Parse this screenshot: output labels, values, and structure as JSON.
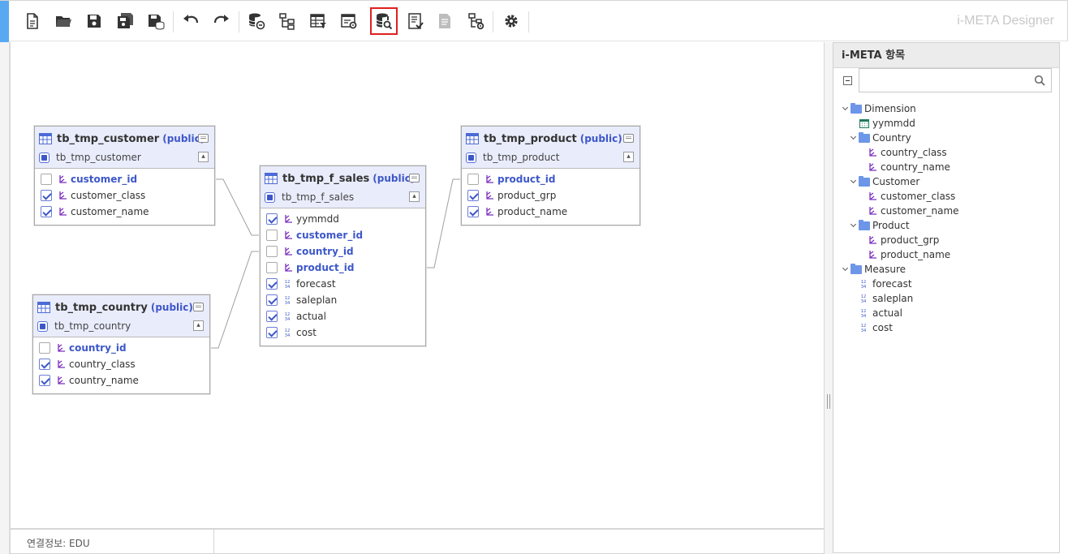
{
  "app": {
    "brand": "i-META Designer"
  },
  "toolbar": {
    "buttons": [
      {
        "name": "new-document",
        "icon": "new-document-icon"
      },
      {
        "name": "open-folder",
        "icon": "folder-open-icon"
      },
      {
        "name": "save",
        "icon": "save-icon"
      },
      {
        "name": "save-as",
        "icon": "save-as-icon"
      },
      {
        "name": "save-db",
        "icon": "save-database-icon"
      },
      {
        "name": "undo",
        "icon": "undo-icon"
      },
      {
        "name": "redo",
        "icon": "redo-icon"
      },
      {
        "name": "db-link",
        "icon": "database-link-icon"
      },
      {
        "name": "tree-structure",
        "icon": "hierarchy-icon"
      },
      {
        "name": "table-filter",
        "icon": "table-filter-icon"
      },
      {
        "name": "table-settings",
        "icon": "table-settings-icon"
      },
      {
        "name": "db-search",
        "icon": "database-search-icon",
        "active": true
      },
      {
        "name": "checklist",
        "icon": "checklist-icon"
      },
      {
        "name": "document-disabled",
        "icon": "document-icon"
      },
      {
        "name": "hierarchy-settings",
        "icon": "hierarchy-settings-icon"
      },
      {
        "name": "settings",
        "icon": "gear-icon"
      }
    ]
  },
  "tables": [
    {
      "id": "tb_tmp_customer",
      "name": "tb_tmp_customer",
      "schema": "(public)",
      "alias": "tb_tmp_customer",
      "columns": [
        {
          "name": "customer_id",
          "checked": false,
          "key": true,
          "type": "dimension"
        },
        {
          "name": "customer_class",
          "checked": true,
          "key": false,
          "type": "dimension"
        },
        {
          "name": "customer_name",
          "checked": true,
          "key": false,
          "type": "dimension"
        }
      ]
    },
    {
      "id": "tb_tmp_country",
      "name": "tb_tmp_country",
      "schema": "(public)",
      "alias": "tb_tmp_country",
      "columns": [
        {
          "name": "country_id",
          "checked": false,
          "key": true,
          "type": "dimension"
        },
        {
          "name": "country_class",
          "checked": true,
          "key": false,
          "type": "dimension"
        },
        {
          "name": "country_name",
          "checked": true,
          "key": false,
          "type": "dimension"
        }
      ]
    },
    {
      "id": "tb_tmp_f_sales",
      "name": "tb_tmp_f_sales",
      "schema": "(public)",
      "alias": "tb_tmp_f_sales",
      "columns": [
        {
          "name": "yymmdd",
          "checked": true,
          "key": false,
          "type": "dimension"
        },
        {
          "name": "customer_id",
          "checked": false,
          "key": true,
          "type": "dimension"
        },
        {
          "name": "country_id",
          "checked": false,
          "key": true,
          "type": "dimension"
        },
        {
          "name": "product_id",
          "checked": false,
          "key": true,
          "type": "dimension"
        },
        {
          "name": "forecast",
          "checked": true,
          "key": false,
          "type": "measure"
        },
        {
          "name": "saleplan",
          "checked": true,
          "key": false,
          "type": "measure"
        },
        {
          "name": "actual",
          "checked": true,
          "key": false,
          "type": "measure"
        },
        {
          "name": "cost",
          "checked": true,
          "key": false,
          "type": "measure"
        }
      ]
    },
    {
      "id": "tb_tmp_product",
      "name": "tb_tmp_product",
      "schema": "(public)",
      "alias": "tb_tmp_product",
      "columns": [
        {
          "name": "product_id",
          "checked": false,
          "key": true,
          "type": "dimension"
        },
        {
          "name": "product_grp",
          "checked": true,
          "key": false,
          "type": "dimension"
        },
        {
          "name": "product_name",
          "checked": true,
          "key": false,
          "type": "dimension"
        }
      ]
    }
  ],
  "panel": {
    "title": "i-META 항목",
    "search": {
      "value": "",
      "placeholder": ""
    },
    "tree": [
      {
        "label": "Dimension",
        "level": 0,
        "kind": "folder",
        "expanded": true
      },
      {
        "label": "yymmdd",
        "level": 1,
        "kind": "date"
      },
      {
        "label": "Country",
        "level": 1,
        "kind": "folder",
        "expanded": true
      },
      {
        "label": "country_class",
        "level": 2,
        "kind": "dimension"
      },
      {
        "label": "country_name",
        "level": 2,
        "kind": "dimension"
      },
      {
        "label": "Customer",
        "level": 1,
        "kind": "folder",
        "expanded": true
      },
      {
        "label": "customer_class",
        "level": 2,
        "kind": "dimension"
      },
      {
        "label": "customer_name",
        "level": 2,
        "kind": "dimension"
      },
      {
        "label": "Product",
        "level": 1,
        "kind": "folder",
        "expanded": true
      },
      {
        "label": "product_grp",
        "level": 2,
        "kind": "dimension"
      },
      {
        "label": "product_name",
        "level": 2,
        "kind": "dimension"
      },
      {
        "label": "Measure",
        "level": 0,
        "kind": "folder",
        "expanded": true
      },
      {
        "label": "forecast",
        "level": 1,
        "kind": "measure"
      },
      {
        "label": "saleplan",
        "level": 1,
        "kind": "measure"
      },
      {
        "label": "actual",
        "level": 1,
        "kind": "measure"
      },
      {
        "label": "cost",
        "level": 1,
        "kind": "measure"
      }
    ]
  },
  "status": {
    "connection": "연결정보: EDU"
  },
  "colors": {
    "accent": "#58a9f2",
    "key": "#3d57c9",
    "header": "#e9ecfb",
    "active_border": "#e02020"
  }
}
